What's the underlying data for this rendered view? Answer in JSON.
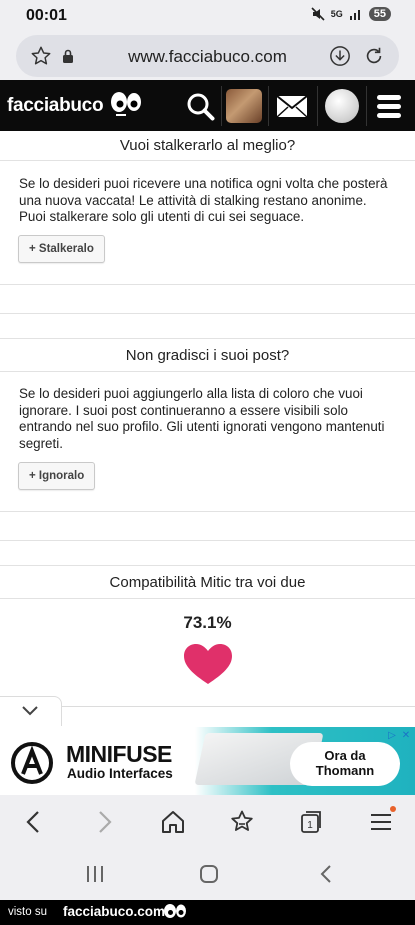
{
  "status_bar": {
    "time": "00:01",
    "network": "5G",
    "battery": "55"
  },
  "browser": {
    "url": "www.facciabuco.com"
  },
  "site": {
    "logo_text": "facciabuco"
  },
  "sections": {
    "stalker": {
      "title": "Vuoi stalkerarlo al meglio?",
      "text": "Se lo desideri puoi ricevere una notifica ogni volta che posterà una nuova vaccata! Le attività di stalking restano anonime. Puoi stalkerare solo gli utenti di cui sei seguace.",
      "button": "+ Stalkeralo"
    },
    "ignore": {
      "title": "Non gradisci i suoi post?",
      "text": "Se lo desideri puoi aggiungerlo alla lista di coloro che vuoi ignorare. I suoi post continueranno a essere visibili solo entrando nel suo profilo. Gli utenti ignorati vengono mantenuti segreti.",
      "button": "+ Ignoralo"
    },
    "compat": {
      "title": "Compatibilità Mitic tra voi due",
      "percent": "73.1%"
    }
  },
  "ad": {
    "title": "MINIFUSE",
    "subtitle": "Audio Interfaces",
    "cta_line1": "Ora da",
    "cta_line2": "Thomann",
    "accent": "#2ec0c5"
  },
  "footer": {
    "visto": "visto su",
    "brand": "facciabuco.com"
  },
  "colors": {
    "header_bg": "#0b0b0b",
    "heart": "#e0306a",
    "toolbar_bg": "#efeff2"
  }
}
